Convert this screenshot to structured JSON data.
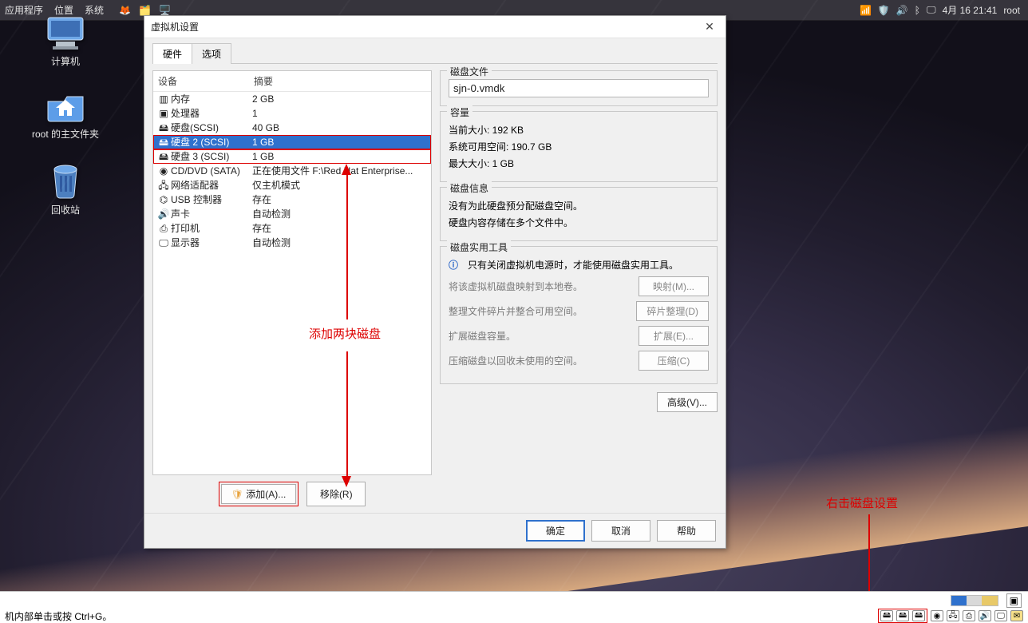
{
  "top_panel": {
    "menu1": "应用程序",
    "menu2": "位置",
    "menu3": "系统",
    "clock": "4月 16 21:41",
    "user": "root"
  },
  "desktop": {
    "icon1": "计算机",
    "icon2": "root 的主文件夹",
    "icon3": "回收站"
  },
  "dialog": {
    "title": "虚拟机设置",
    "tab_hw": "硬件",
    "tab_opt": "选项",
    "col_device": "设备",
    "col_summary": "摘要",
    "devices": [
      {
        "n": "内存",
        "s": "2 GB",
        "sel": false,
        "box": false,
        "ico": "mem"
      },
      {
        "n": "处理器",
        "s": "1",
        "sel": false,
        "box": false,
        "ico": "cpu"
      },
      {
        "n": "硬盘(SCSI)",
        "s": "40 GB",
        "sel": false,
        "box": false,
        "ico": "hdd"
      },
      {
        "n": "硬盘 2 (SCSI)",
        "s": "1 GB",
        "sel": true,
        "box": true,
        "ico": "hdd"
      },
      {
        "n": "硬盘 3 (SCSI)",
        "s": "1 GB",
        "sel": false,
        "box": true,
        "ico": "hdd"
      },
      {
        "n": "CD/DVD (SATA)",
        "s": "正在使用文件 F:\\Red Hat Enterprise...",
        "sel": false,
        "box": false,
        "ico": "cd"
      },
      {
        "n": "网络适配器",
        "s": "仅主机模式",
        "sel": false,
        "box": false,
        "ico": "net"
      },
      {
        "n": "USB 控制器",
        "s": "存在",
        "sel": false,
        "box": false,
        "ico": "usb"
      },
      {
        "n": "声卡",
        "s": "自动检测",
        "sel": false,
        "box": false,
        "ico": "snd"
      },
      {
        "n": "打印机",
        "s": "存在",
        "sel": false,
        "box": false,
        "ico": "prn"
      },
      {
        "n": "显示器",
        "s": "自动检测",
        "sel": false,
        "box": false,
        "ico": "dsp"
      }
    ],
    "btn_add": "添加(A)...",
    "btn_remove": "移除(R)",
    "right": {
      "g1_title": "磁盘文件",
      "g1_value": "sjn-0.vmdk",
      "g2_title": "容量",
      "g2_l1": "当前大小: 192 KB",
      "g2_l2": "系统可用空间: 190.7 GB",
      "g2_l3": "最大大小: 1 GB",
      "g3_title": "磁盘信息",
      "g3_l1": "没有为此硬盘预分配磁盘空间。",
      "g3_l2": "硬盘内容存储在多个文件中。",
      "g4_title": "磁盘实用工具",
      "g4_info": "只有关闭虚拟机电源时，才能使用磁盘实用工具。",
      "g4_r1": "将该虚拟机磁盘映射到本地卷。",
      "g4_b1": "映射(M)...",
      "g4_r2": "整理文件碎片并整合可用空间。",
      "g4_b2": "碎片整理(D)",
      "g4_r3": "扩展磁盘容量。",
      "g4_b3": "扩展(E)...",
      "g4_r4": "压缩磁盘以回收未使用的空间。",
      "g4_b4": "压缩(C)",
      "btn_adv": "高级(V)..."
    },
    "footer": {
      "ok": "确定",
      "cancel": "取消",
      "help": "帮助"
    }
  },
  "annotations": {
    "a1": "添加两块磁盘",
    "a2": "右击磁盘设置"
  },
  "host": {
    "status": "机内部单击或按 Ctrl+G。"
  }
}
